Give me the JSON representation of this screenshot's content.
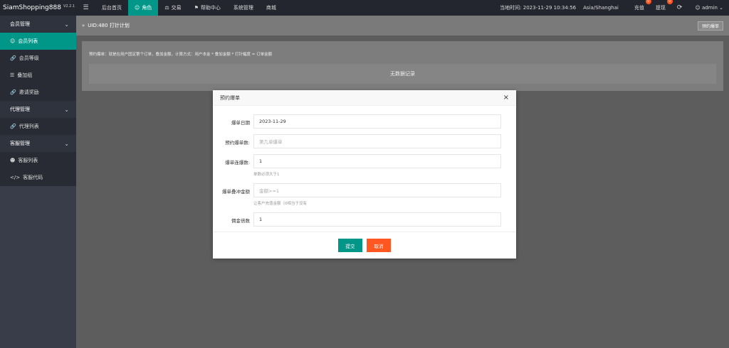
{
  "app": {
    "brand": "SiamShopping888",
    "version": "V2.2.1"
  },
  "topnav": {
    "menu_icon": "menu-icon",
    "items": [
      {
        "label": "后台首页",
        "icon": "",
        "active": false
      },
      {
        "label": "角色",
        "icon": "user-icon",
        "active": true
      },
      {
        "label": "交易",
        "icon": "scale-icon",
        "active": false
      },
      {
        "label": "帮助中心",
        "icon": "flag-icon",
        "active": false
      },
      {
        "label": "系统管理",
        "icon": "",
        "active": false
      },
      {
        "label": "商城",
        "icon": "",
        "active": false
      }
    ]
  },
  "topright": {
    "time_label": "当地时间: 2023-11-29 10:34:56",
    "timezone": "Asia/Shanghai",
    "recharge_label": "充值",
    "recharge_count": "0",
    "withdraw_label": "提现",
    "withdraw_count": "0",
    "user": "admin"
  },
  "sidebar": {
    "groups": [
      {
        "label": "会员管理",
        "items": [
          {
            "label": "会员列表",
            "icon": "user-icon",
            "active": true
          },
          {
            "label": "会员等级",
            "icon": "link-icon",
            "active": false
          },
          {
            "label": "叠加组",
            "icon": "list-icon",
            "active": false
          },
          {
            "label": "邀请奖励",
            "icon": "link-icon",
            "active": false
          }
        ]
      },
      {
        "label": "代理管理",
        "items": [
          {
            "label": "代理列表",
            "icon": "link-icon",
            "active": false
          }
        ]
      },
      {
        "label": "客服管理",
        "items": [
          {
            "label": "客服列表",
            "icon": "users-icon",
            "active": false
          },
          {
            "label": "客服代码",
            "icon": "code-icon",
            "active": false
          }
        ]
      }
    ]
  },
  "crumb": {
    "title": "UID:480 打针计划",
    "button": "预约爆单"
  },
  "panel": {
    "description": "预约爆单：就是在用户固定第个订单，叠加金额，计算方式：用户本金 * 叠加金额 * 打针幅度 = 订单金额",
    "empty_text": "无数据记录"
  },
  "modal": {
    "title": "预约爆单",
    "fields": [
      {
        "label": "爆单日期",
        "value": "2023-11-29",
        "placeholder": "",
        "hint": ""
      },
      {
        "label": "预约爆单数:",
        "value": "",
        "placeholder": "第几单爆单",
        "hint": ""
      },
      {
        "label": "爆单连爆数:",
        "value": "1",
        "placeholder": "",
        "hint": "单数必须大于1"
      },
      {
        "label": "爆单叠冲金额",
        "value": "",
        "placeholder": "金额>=1",
        "hint": "让客户充值金额（0相当于没有"
      },
      {
        "label": "佣金倍数",
        "value": "1",
        "placeholder": "",
        "hint": ""
      }
    ],
    "ok_label": "提交",
    "cancel_label": "取消"
  },
  "colors": {
    "accent": "#009688",
    "danger": "#ff5722",
    "topbar": "#23262e",
    "sidebar": "#393d49"
  }
}
